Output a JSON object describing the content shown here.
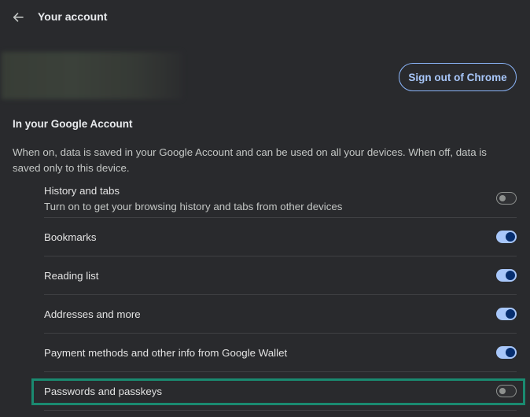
{
  "header": {
    "back_icon": "arrow-left-icon",
    "title": "Your account"
  },
  "account": {
    "signout_label": "Sign out of Chrome"
  },
  "section": {
    "heading": "In your Google Account",
    "description": "When on, data is saved in your Google Account and can be used on all your devices. When off, data is saved only to this device."
  },
  "sync_items": [
    {
      "label": "History and tabs",
      "sublabel": "Turn on to get your browsing history and tabs from other devices",
      "on": false
    },
    {
      "label": "Bookmarks",
      "on": true
    },
    {
      "label": "Reading list",
      "on": true
    },
    {
      "label": "Addresses and more",
      "on": true
    },
    {
      "label": "Payment methods and other info from Google Wallet",
      "on": true
    },
    {
      "label": "Passwords and passkeys",
      "on": false
    }
  ],
  "colors": {
    "background": "#292a2d",
    "accent": "#a8c7fa",
    "highlight": "#1a8a70"
  }
}
